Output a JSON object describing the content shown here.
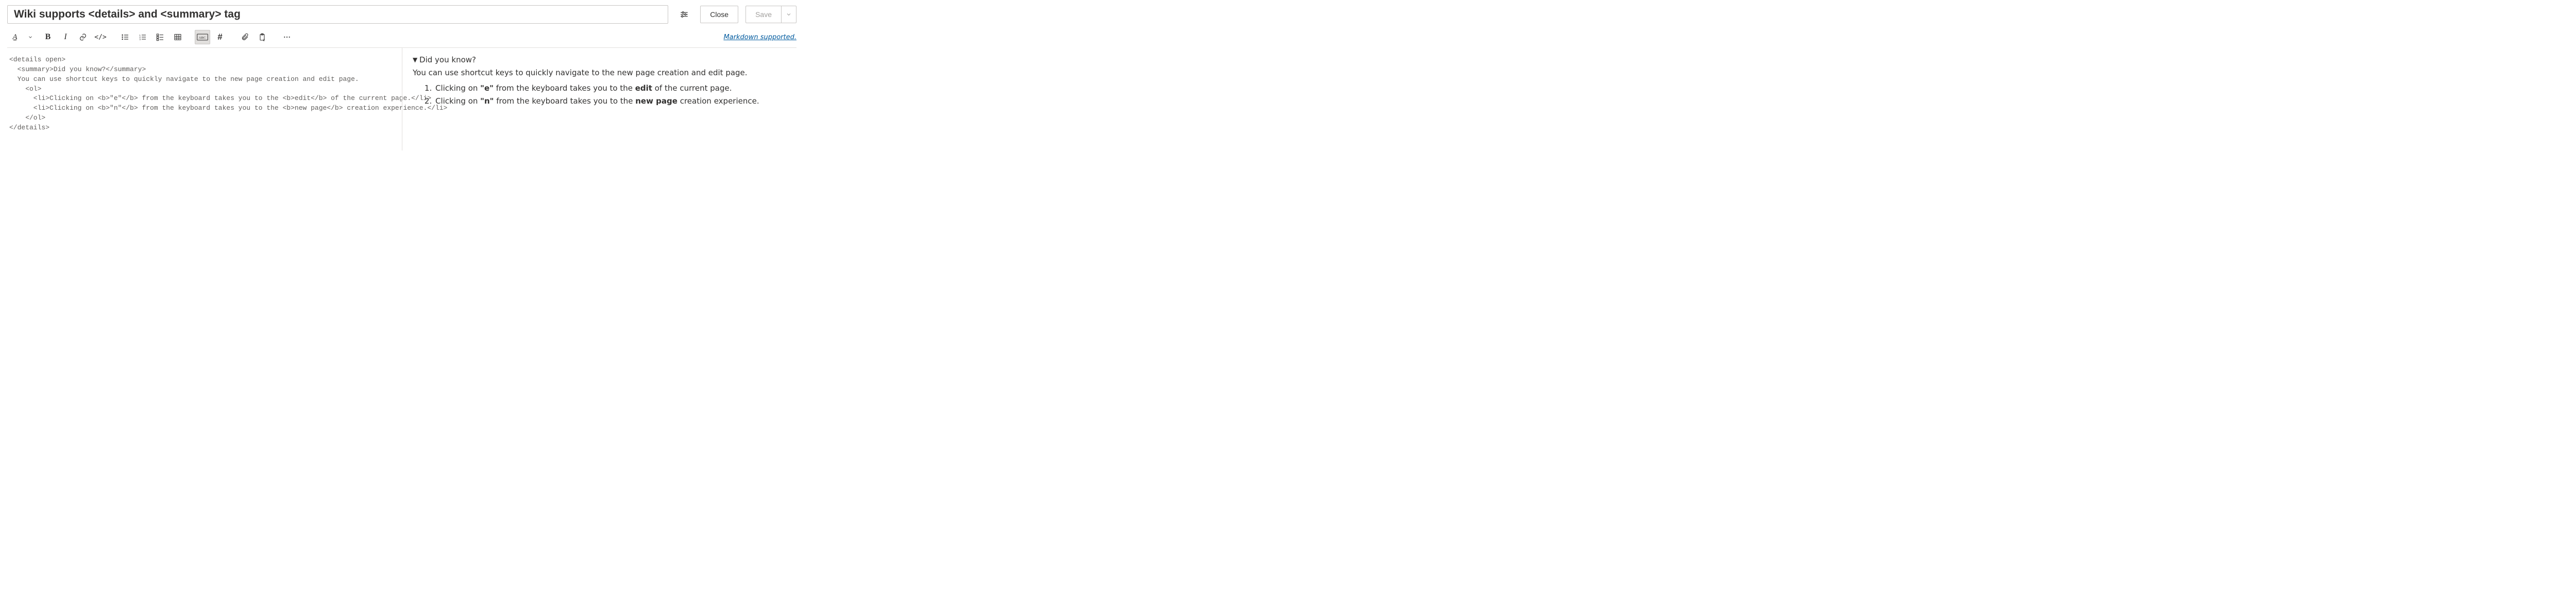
{
  "title": "Wiki supports <details> and <summary> tag",
  "buttons": {
    "close": "Close",
    "save": "Save"
  },
  "markdown_link": "Markdown supported.",
  "toolbar": {
    "font_color": "Clear formatting / font color",
    "bold": "Bold",
    "italic": "Italic",
    "link": "Link",
    "code": "Code",
    "bulleted": "Bulleted list",
    "numbered": "Numbered list",
    "checklist": "Task list",
    "table": "Table",
    "image": "Insert image",
    "header": "Header",
    "attach": "Attach",
    "paste": "Paste",
    "more": "More options",
    "settings": "Editor settings"
  },
  "source_lines": [
    "<details open>",
    "  <summary>Did you know?</summary>",
    "  You can use shortcut keys to quickly navigate to the new page creation and edit page.",
    "    <ol>",
    "      <li>Clicking on <b>\"e\"</b> from the keyboard takes you to the <b>edit</b> of the current page.</li>",
    "      <li>Clicking on <b>\"n\"</b> from the keyboard takes you to the <b>new page</b> creation experience.</li>",
    "    </ol>",
    "</details>"
  ],
  "preview": {
    "summary": "Did you know?",
    "intro": "You can use shortcut keys to quickly navigate to the new page creation and edit page.",
    "items": [
      {
        "pre": "Clicking on ",
        "b1": "\"e\"",
        "mid": " from the keyboard takes you to the ",
        "b2": "edit",
        "post": " of the current page."
      },
      {
        "pre": "Clicking on ",
        "b1": "\"n\"",
        "mid": " from the keyboard takes you to the ",
        "b2": "new page",
        "post": " creation experience."
      }
    ]
  }
}
